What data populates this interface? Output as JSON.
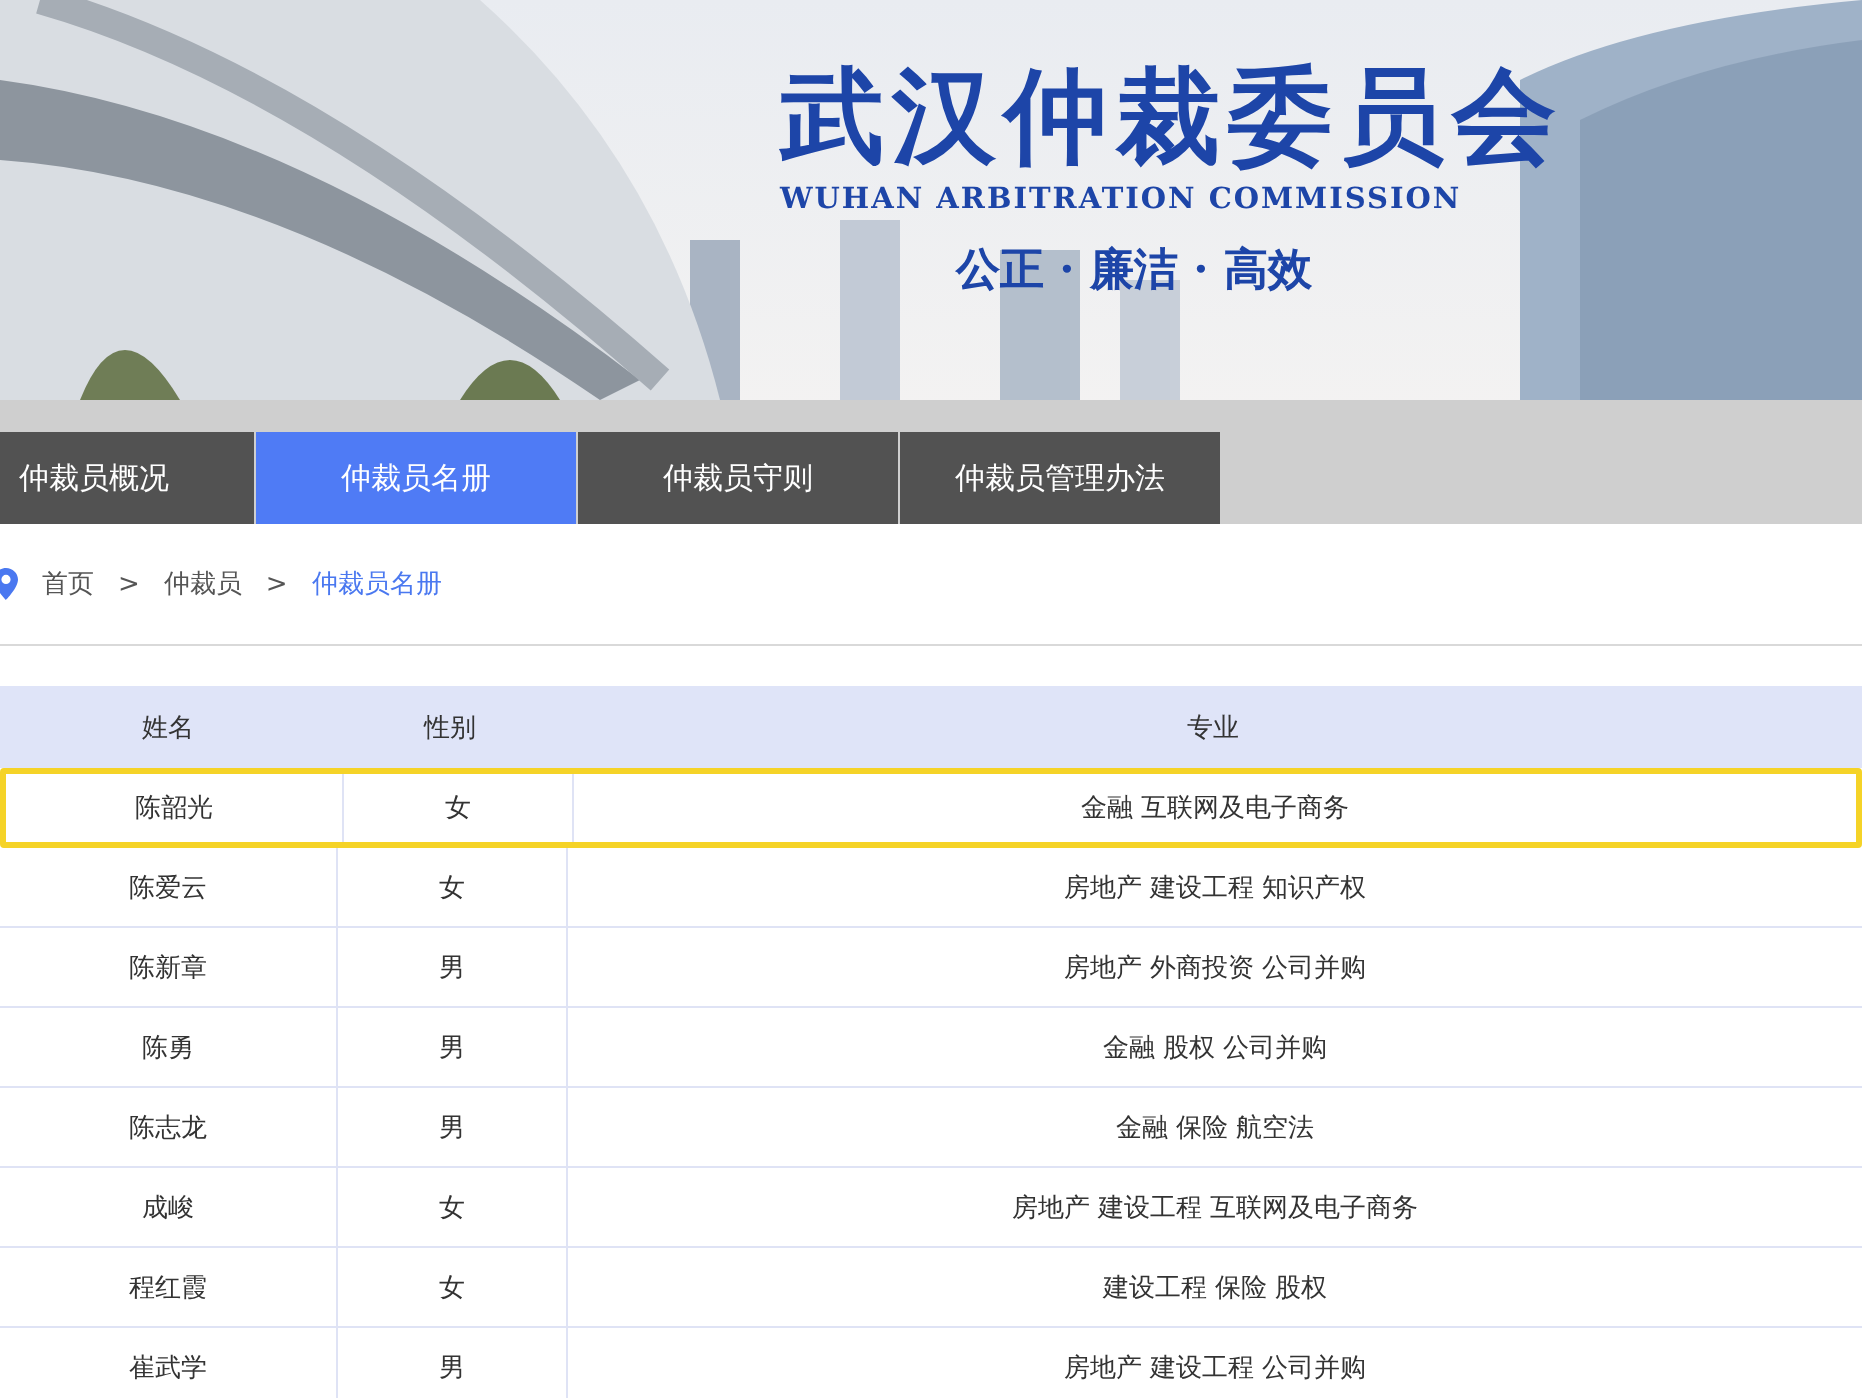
{
  "banner": {
    "title": "武汉仲裁委员会",
    "subtitle": "WUHAN ARBITRATION COMMISSION",
    "motto": "公正 · 廉洁 · 高效"
  },
  "tabs": [
    {
      "label": "仲裁员概况",
      "selected": false
    },
    {
      "label": "仲裁员名册",
      "selected": true
    },
    {
      "label": "仲裁员守则",
      "selected": false
    },
    {
      "label": "仲裁员管理办法",
      "selected": false
    }
  ],
  "breadcrumb": [
    {
      "label": "首页",
      "current": false
    },
    {
      "label": "仲裁员",
      "current": false
    },
    {
      "label": "仲裁员名册",
      "current": true
    }
  ],
  "breadcrumb_separator": ">",
  "table": {
    "columns": [
      "姓名",
      "性别",
      "专业"
    ],
    "rows": [
      {
        "cells": [
          "陈韶光",
          "女",
          "金融 互联网及电子商务"
        ],
        "selected": true
      },
      {
        "cells": [
          "陈爱云",
          "女",
          "房地产 建设工程 知识产权"
        ],
        "selected": false
      },
      {
        "cells": [
          "陈新章",
          "男",
          "房地产 外商投资 公司并购"
        ],
        "selected": false
      },
      {
        "cells": [
          "陈勇",
          "男",
          "金融 股权 公司并购"
        ],
        "selected": false
      },
      {
        "cells": [
          "陈志龙",
          "男",
          "金融 保险 航空法"
        ],
        "selected": false
      },
      {
        "cells": [
          "成峻",
          "女",
          "房地产 建设工程 互联网及电子商务"
        ],
        "selected": false
      },
      {
        "cells": [
          "程红霞",
          "女",
          "建设工程 保险 股权"
        ],
        "selected": false
      },
      {
        "cells": [
          "崔武学",
          "男",
          "房地产 建设工程 公司并购"
        ],
        "selected": false
      }
    ]
  }
}
